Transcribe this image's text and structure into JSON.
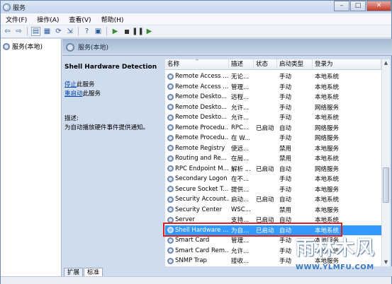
{
  "window": {
    "title": "服务"
  },
  "menu": [
    "文件(F)",
    "操作(A)",
    "查看(V)",
    "帮助(H)"
  ],
  "tree": {
    "root": "服务(本地)"
  },
  "panel": {
    "title": "服务(本地)"
  },
  "details": {
    "service_name": "Shell Hardware Detection",
    "stop_link": "停止",
    "stop_suffix": "此服务",
    "restart_link": "重启动",
    "restart_suffix": "此服务",
    "desc_label": "描述:",
    "desc_text": "为自动播放硬件事件提供通知。"
  },
  "list": {
    "columns": [
      "名称",
      "描述",
      "状态",
      "启动类型",
      "登录为"
    ],
    "rows": [
      {
        "name": "Remote Access ...",
        "desc": "无论...",
        "state": "",
        "start": "手动",
        "login": "本地系统"
      },
      {
        "name": "Remote Access ...",
        "desc": "管理...",
        "state": "",
        "start": "手动",
        "login": "本地系统"
      },
      {
        "name": "Remote Deskto...",
        "desc": "远程...",
        "state": "",
        "start": "手动",
        "login": "本地系统"
      },
      {
        "name": "Remote Deskto...",
        "desc": "允许...",
        "state": "",
        "start": "手动",
        "login": "网络服务"
      },
      {
        "name": "Remote Deskto...",
        "desc": "允许...",
        "state": "",
        "start": "手动",
        "login": "本地系统"
      },
      {
        "name": "Remote Procedu...",
        "desc": "RPC...",
        "state": "已启动",
        "start": "自动",
        "login": "网络服务"
      },
      {
        "name": "Remote Procedu...",
        "desc": "在 W...",
        "state": "",
        "start": "手动",
        "login": "网络服务"
      },
      {
        "name": "Remote Registry",
        "desc": "使远...",
        "state": "",
        "start": "禁用",
        "login": "本地服务"
      },
      {
        "name": "Routing and Re...",
        "desc": "在局...",
        "state": "",
        "start": "禁用",
        "login": "本地系统"
      },
      {
        "name": "RPC Endpoint M...",
        "desc": "解析 ...",
        "state": "已启动",
        "start": "自动",
        "login": "网络服务"
      },
      {
        "name": "Secondary Logon",
        "desc": "在不...",
        "state": "",
        "start": "手动",
        "login": "本地系统"
      },
      {
        "name": "Secure Socket T...",
        "desc": "提供...",
        "state": "",
        "start": "手动",
        "login": "本地服务"
      },
      {
        "name": "Security Account...",
        "desc": "启动...",
        "state": "已启动",
        "start": "自动",
        "login": "本地系统"
      },
      {
        "name": "Security Center",
        "desc": "WSC...",
        "state": "",
        "start": "禁用",
        "login": "本地服务"
      },
      {
        "name": "Server",
        "desc": "支持...",
        "state": "已启动",
        "start": "自动",
        "login": "本地系统"
      },
      {
        "name": "Shell Hardware ...",
        "desc": "为自...",
        "state": "已启动",
        "start": "自动",
        "login": "本地系统",
        "selected": true
      },
      {
        "name": "Smart Card",
        "desc": "管理...",
        "state": "",
        "start": "手动",
        "login": "本地服务"
      },
      {
        "name": "Smart Card Rem...",
        "desc": "允许...",
        "state": "",
        "start": "手动",
        "login": "本地系统"
      },
      {
        "name": "SNMP Trap",
        "desc": "接收...",
        "state": "",
        "start": "手动",
        "login": "本地服务"
      }
    ]
  },
  "tabs": [
    "扩展",
    "标准"
  ],
  "watermark": {
    "main": "雨林木风",
    "sub": "WWW.YLMFU.COM"
  }
}
